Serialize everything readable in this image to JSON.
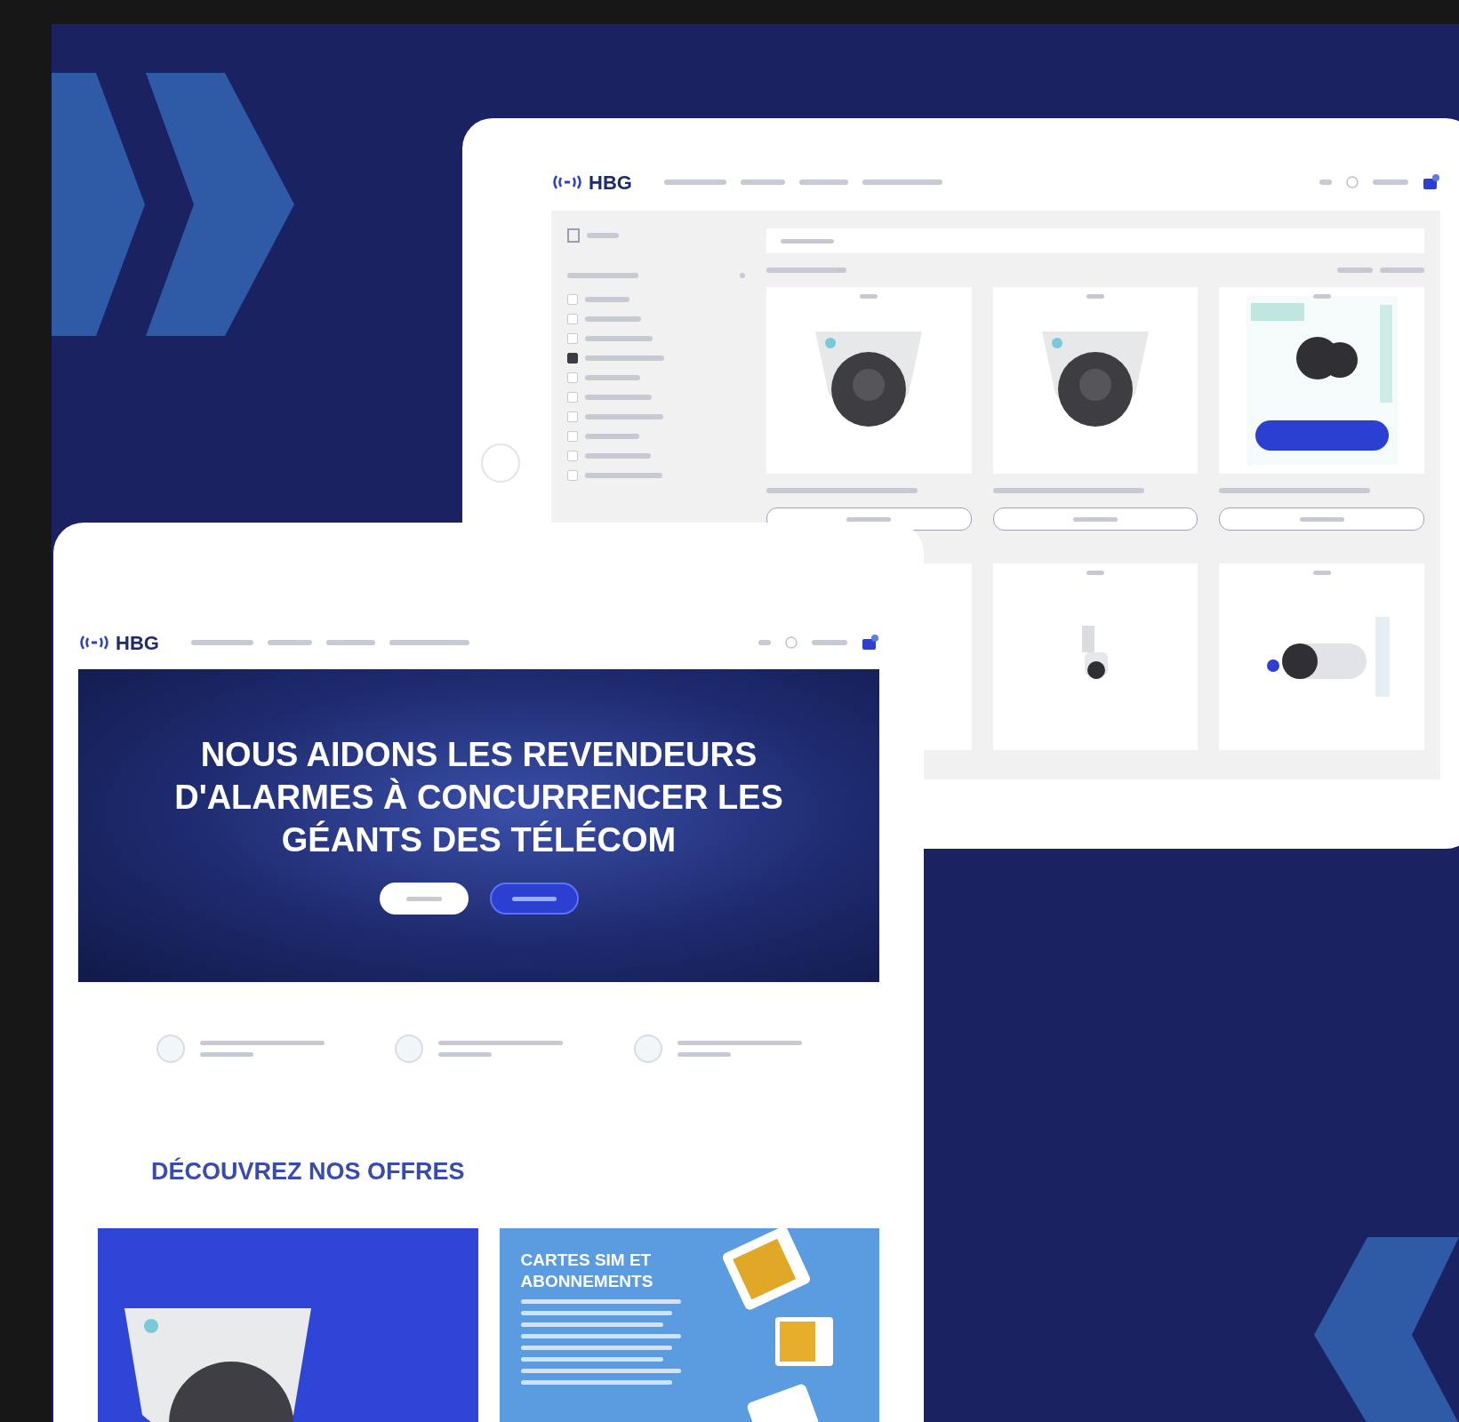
{
  "back_screen": {
    "logo": "HBG",
    "category_filters": [
      {
        "checked": false
      },
      {
        "checked": false
      },
      {
        "checked": false
      },
      {
        "checked": true
      },
      {
        "checked": false
      },
      {
        "checked": false
      },
      {
        "checked": false
      },
      {
        "checked": false
      },
      {
        "checked": false
      },
      {
        "checked": false
      }
    ],
    "products": [
      {
        "kind": "dome"
      },
      {
        "kind": "dome"
      },
      {
        "kind": "promo"
      },
      {
        "kind": "blank"
      },
      {
        "kind": "ptz"
      },
      {
        "kind": "bullet"
      }
    ]
  },
  "front_screen": {
    "logo": "HBG",
    "headline_lines": [
      "NOUS AIDONS LES REVENDEURS",
      "D'ALARMES À CONCURRENCER LES",
      "GÉANTS DES TÉLÉCOM"
    ],
    "section_title": "DÉCOUVREZ NOS OFFRES",
    "offers": [
      {
        "kind": "photo"
      },
      {
        "kind": "text",
        "title": "CARTES SIM ET ABONNEMENTS"
      }
    ]
  }
}
